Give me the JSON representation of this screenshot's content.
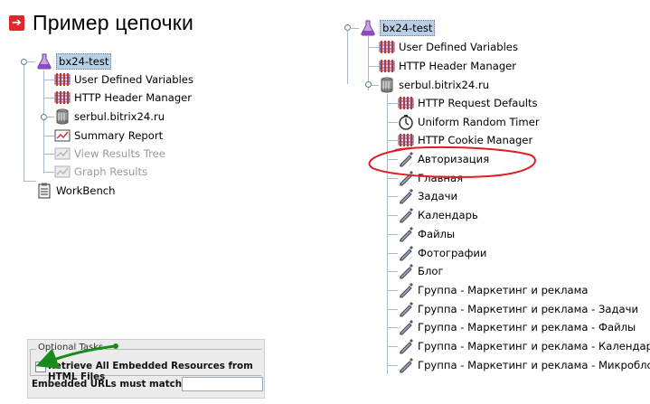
{
  "heading": {
    "text": "Пример цепочки",
    "icon": "arrow-right-icon",
    "color": "#e3262b"
  },
  "left_tree": {
    "root": {
      "label": "bx24-test",
      "icon": "flask-icon"
    },
    "children": [
      {
        "label": "User Defined Variables",
        "icon": "config-element-icon"
      },
      {
        "label": "HTTP Header Manager",
        "icon": "config-element-icon"
      },
      {
        "label": "serbul.bitrix24.ru",
        "icon": "thread-group-icon"
      },
      {
        "label": "Summary Report",
        "icon": "report-icon"
      },
      {
        "label": "View Results Tree",
        "icon": "listener-icon",
        "disabled": true
      },
      {
        "label": "Graph Results",
        "icon": "listener-icon",
        "disabled": true
      }
    ],
    "workbench": {
      "label": "WorkBench",
      "icon": "clipboard-icon"
    }
  },
  "right_tree": {
    "root": {
      "label": "bx24-test",
      "icon": "flask-icon"
    },
    "top_children": [
      {
        "label": "User Defined Variables",
        "icon": "config-element-icon"
      },
      {
        "label": "HTTP Header Manager",
        "icon": "config-element-icon"
      }
    ],
    "thread_group": {
      "label": "serbul.bitrix24.ru",
      "icon": "thread-group-icon"
    },
    "items": [
      {
        "label": "HTTP Request Defaults",
        "icon": "config-element-icon"
      },
      {
        "label": "Uniform Random Timer",
        "icon": "timer-icon"
      },
      {
        "label": "HTTP Cookie Manager",
        "icon": "config-element-icon"
      },
      {
        "label": "Авторизация",
        "icon": "sampler-pen-icon"
      },
      {
        "label": "Главная",
        "icon": "sampler-pen-icon"
      },
      {
        "label": "Задачи",
        "icon": "sampler-pen-icon"
      },
      {
        "label": "Календарь",
        "icon": "sampler-pen-icon"
      },
      {
        "label": "Файлы",
        "icon": "sampler-pen-icon"
      },
      {
        "label": "Фотографии",
        "icon": "sampler-pen-icon"
      },
      {
        "label": "Блог",
        "icon": "sampler-pen-icon"
      },
      {
        "label": "Группа - Маркетинг и реклама",
        "icon": "sampler-pen-icon"
      },
      {
        "label": "Группа - Маркетинг и реклама - Задачи",
        "icon": "sampler-pen-icon"
      },
      {
        "label": "Группа - Маркетинг и реклама - Файлы",
        "icon": "sampler-pen-icon"
      },
      {
        "label": "Группа - Маркетинг и реклама - Календарь",
        "icon": "sampler-pen-icon"
      },
      {
        "label": "Группа - Маркетинг и реклама - Микроблог",
        "icon": "sampler-pen-icon"
      }
    ],
    "highlight_color": "#e31b23"
  },
  "optional_tasks": {
    "legend": "Optional Tasks",
    "checkbox_label": "Retrieve All Embedded Resources from HTML Files",
    "checkbox_checked": false,
    "embedded_label": "Embedded URLs must match:",
    "embedded_value": "",
    "arrow_color": "#1a8a1a"
  }
}
